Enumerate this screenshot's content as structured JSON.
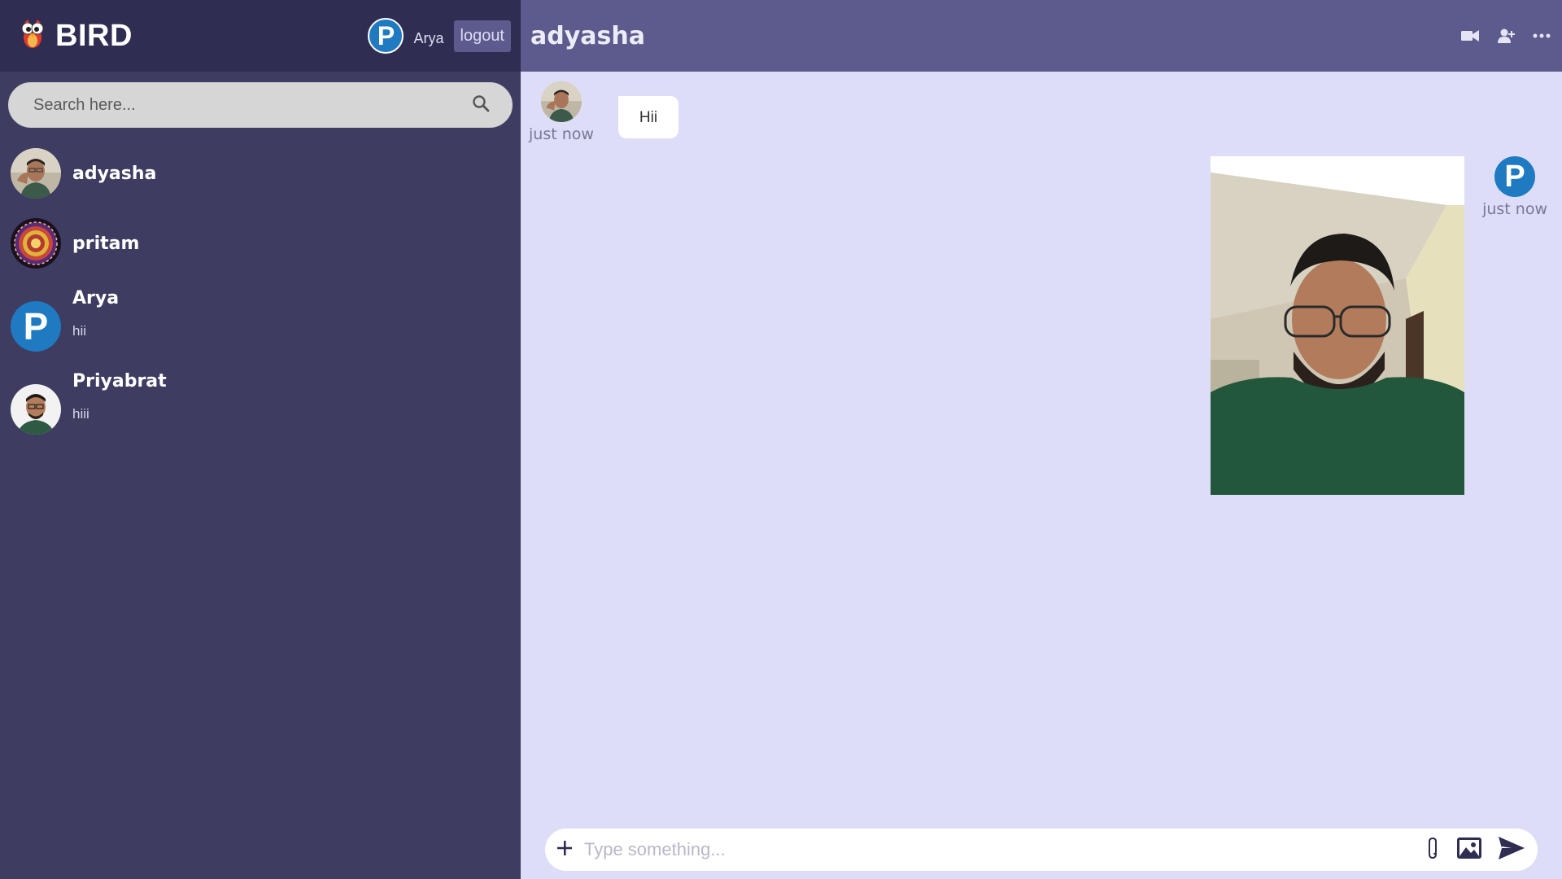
{
  "sidebar": {
    "brand": {
      "title": "BIRD",
      "icon": "bird-logo-icon"
    },
    "current_user": {
      "initial": "P",
      "name": "Arya"
    },
    "logout_label": "logout",
    "search": {
      "placeholder": "Search here...",
      "icon": "search-icon"
    },
    "chats": [
      {
        "name": "adyasha",
        "last_message": ""
      },
      {
        "name": "pritam",
        "last_message": ""
      },
      {
        "name": "Arya",
        "last_message": "hii",
        "initial": "P"
      },
      {
        "name": "Priyabrat",
        "last_message": "hiii"
      }
    ]
  },
  "main": {
    "title": "adyasha",
    "header_icons": [
      "video-camera-icon",
      "add-user-icon",
      "more-options-icon"
    ],
    "messages": [
      {
        "side": "left",
        "text": "Hii",
        "time": "just now"
      },
      {
        "side": "right",
        "type": "image",
        "time": "just now",
        "initial": "P"
      }
    ],
    "input": {
      "placeholder": "Type something..."
    },
    "input_icons": [
      "plus-icon",
      "attach-icon",
      "image-icon",
      "send-icon"
    ]
  },
  "colors": {
    "sidebar_bg": "#3e3c61",
    "sidebar_header_bg": "#2f2d52",
    "main_header_bg": "#5d5b8d",
    "chat_bg": "#ddddf7",
    "avatar_blue": "#1f7ac2"
  }
}
